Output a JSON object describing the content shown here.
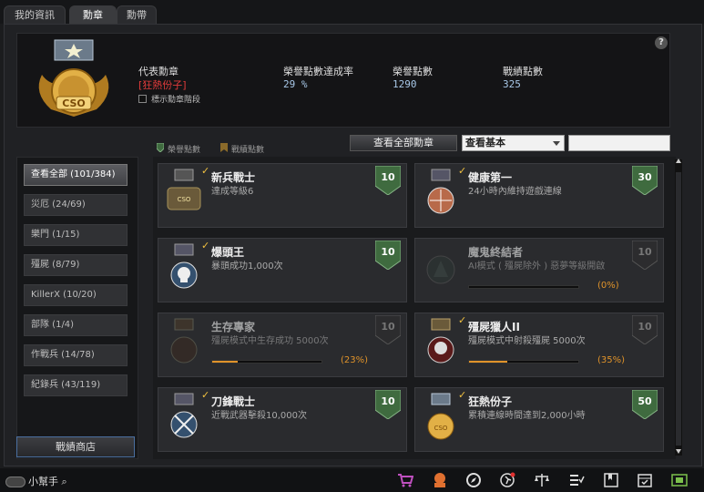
{
  "tabs": [
    {
      "label": "我的資訊"
    },
    {
      "label": "勳章"
    },
    {
      "label": "勳帶"
    }
  ],
  "header": {
    "help": "?",
    "representative_label": "代表勳章",
    "representative_value": "[狂熱份子]",
    "show_rank_label": "標示勳章階段",
    "achievement_rate_label": "榮譽點數達成率",
    "achievement_rate_value": "29 %",
    "honor_points_label": "榮譽點數",
    "honor_points_value": "1290",
    "battle_points_label": "戰績點數",
    "battle_points_value": "325"
  },
  "legend": {
    "honor": "榮譽點數",
    "battle": "戰績點數"
  },
  "controls": {
    "view_all": "查看全部勳章",
    "select_value": "查看基本"
  },
  "categories": [
    {
      "label": "查看全部 (101/384)"
    },
    {
      "label": "災厄 (24/69)"
    },
    {
      "label": "樂門 (1/15)"
    },
    {
      "label": "殭屍 (8/79)"
    },
    {
      "label": "KillerX (10/20)"
    },
    {
      "label": "部隊 (1/4)"
    },
    {
      "label": "作戰兵 (14/78)"
    },
    {
      "label": "紀錄兵 (43/119)"
    }
  ],
  "shop_label": "戰績商店",
  "medals": [
    {
      "name": "新兵戰士",
      "desc": "達成等級6",
      "points": "10",
      "done": true,
      "icon": "welcome-cso-medal-icon"
    },
    {
      "name": "健康第一",
      "desc": "24小時內維持遊戲連線",
      "points": "30",
      "done": true,
      "icon": "crosshair-medal-icon"
    },
    {
      "name": "爆頭王",
      "desc": "暴頭成功1,000次",
      "points": "10",
      "done": true,
      "icon": "skull-medal-icon"
    },
    {
      "name": "魔鬼終結者",
      "desc": "AI模式 ( 殭屍除外 ) 惡夢等級開啟",
      "points": "10",
      "done": false,
      "progress": 0,
      "progress_label": "(0%)",
      "icon": "demon-medal-icon"
    },
    {
      "name": "生存專家",
      "desc": "殭屍模式中生存成功  5000次",
      "points": "10",
      "done": false,
      "progress": 23,
      "progress_label": "(23%)",
      "icon": "survival-medal-icon"
    },
    {
      "name": "殭屍獵人II",
      "desc": "殭屍模式中射殺殭屍  5000次",
      "points": "10",
      "done": true,
      "progress": 35,
      "progress_label": "(35%)",
      "icon": "zombie-skull-medal-icon"
    },
    {
      "name": "刀鋒戰士",
      "desc": "近戰武器擊殺10,000次",
      "points": "10",
      "done": true,
      "icon": "blade-medal-icon"
    },
    {
      "name": "狂熱份子",
      "desc": "累積連線時間達到2,000小時",
      "points": "50",
      "done": true,
      "icon": "cso-wing-medal-icon"
    }
  ],
  "bottom": {
    "helper": "小幫手"
  },
  "colors": {
    "accent_green": "#3f6b3f",
    "progress": "#e0932a",
    "red": "#e23b3b"
  }
}
